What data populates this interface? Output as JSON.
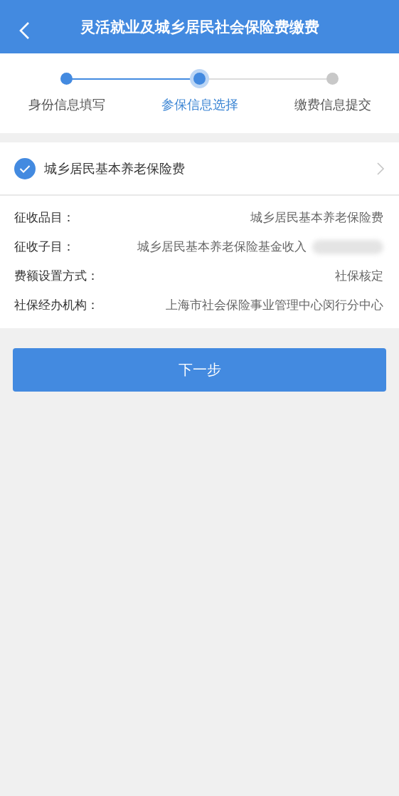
{
  "header": {
    "title": "灵活就业及城乡居民社会保险费缴费"
  },
  "steps": [
    {
      "label": "身份信息填写",
      "kind": "done"
    },
    {
      "label": "参保信息选择",
      "kind": "current"
    },
    {
      "label": "缴费信息提交",
      "kind": "todo"
    }
  ],
  "insurance_item": {
    "label": "城乡居民基本养老保险费",
    "checked": true
  },
  "details": [
    {
      "label": "征收品目：",
      "value": "城乡居民基本养老保险费",
      "redacted": false
    },
    {
      "label": "征收子目：",
      "value": "城乡居民基本养老保险基金收入",
      "redacted": true
    },
    {
      "label": "费额设置方式：",
      "value": "社保核定",
      "redacted": false
    },
    {
      "label": "社保经办机构：",
      "value": "上海市社会保险事业管理中心闵行分中心",
      "redacted": false
    }
  ],
  "next_button": {
    "label": "下一步"
  }
}
